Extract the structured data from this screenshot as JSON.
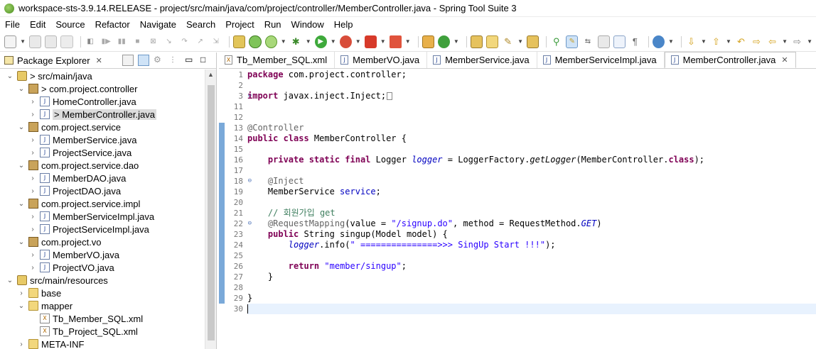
{
  "window": {
    "title": "workspace-sts-3.9.14.RELEASE - project/src/main/java/com/project/controller/MemberController.java - Spring Tool Suite 3"
  },
  "menu": [
    "File",
    "Edit",
    "Source",
    "Refactor",
    "Navigate",
    "Search",
    "Project",
    "Run",
    "Window",
    "Help"
  ],
  "explorer": {
    "title": "Package Explorer",
    "tree": [
      {
        "label": "> src/main/java",
        "icon": "source-folder-icon",
        "twisty": "expanded"
      },
      {
        "label": "> com.project.controller",
        "icon": "package-icon",
        "twisty": "expanded"
      },
      {
        "label": "HomeController.java",
        "icon": "java-file-icon",
        "twisty": "collapsed"
      },
      {
        "label": "> MemberController.java",
        "icon": "java-file-icon",
        "twisty": "collapsed"
      },
      {
        "label": "com.project.service",
        "icon": "package-icon",
        "twisty": "expanded"
      },
      {
        "label": "MemberService.java",
        "icon": "java-file-icon",
        "twisty": "collapsed"
      },
      {
        "label": "ProjectService.java",
        "icon": "java-file-icon",
        "twisty": "collapsed"
      },
      {
        "label": "com.project.service.dao",
        "icon": "package-icon",
        "twisty": "expanded"
      },
      {
        "label": "MemberDAO.java",
        "icon": "java-file-icon",
        "twisty": "collapsed"
      },
      {
        "label": "ProjectDAO.java",
        "icon": "java-file-icon",
        "twisty": "collapsed"
      },
      {
        "label": "com.project.service.impl",
        "icon": "package-icon",
        "twisty": "expanded"
      },
      {
        "label": "MemberServiceImpl.java",
        "icon": "java-file-icon",
        "twisty": "collapsed"
      },
      {
        "label": "ProjectServiceImpl.java",
        "icon": "java-file-icon",
        "twisty": "collapsed"
      },
      {
        "label": "com.project.vo",
        "icon": "package-icon",
        "twisty": "expanded"
      },
      {
        "label": "MemberVO.java",
        "icon": "java-file-icon",
        "twisty": "collapsed"
      },
      {
        "label": "ProjectVO.java",
        "icon": "java-file-icon",
        "twisty": "collapsed"
      },
      {
        "label": "src/main/resources",
        "icon": "source-folder-icon",
        "twisty": "expanded"
      },
      {
        "label": "base",
        "icon": "folder-icon",
        "twisty": "collapsed"
      },
      {
        "label": "mapper",
        "icon": "folder-icon",
        "twisty": "expanded"
      },
      {
        "label": "Tb_Member_SQL.xml",
        "icon": "xml-file-icon",
        "twisty": ""
      },
      {
        "label": "Tb_Project_SQL.xml",
        "icon": "xml-file-icon",
        "twisty": ""
      },
      {
        "label": "META-INF",
        "icon": "folder-icon",
        "twisty": "collapsed"
      }
    ]
  },
  "editor": {
    "tabs": [
      {
        "label": "Tb_Member_SQL.xml",
        "active": false
      },
      {
        "label": "MemberVO.java",
        "active": false
      },
      {
        "label": "MemberService.java",
        "active": false
      },
      {
        "label": "MemberServiceImpl.java",
        "active": false
      },
      {
        "label": "MemberController.java",
        "active": true
      }
    ],
    "line_numbers": [
      "1",
      "2",
      "3",
      "11",
      "12",
      "13",
      "14",
      "15",
      "16",
      "17",
      "18",
      "19",
      "20",
      "21",
      "22",
      "23",
      "24",
      "25",
      "26",
      "27",
      "28",
      "29",
      "30"
    ],
    "lines": {
      "l1_kw": "package",
      "l1_rest": " com.project.controller;",
      "l3_kw": "import",
      "l3_rest": " javax.inject.Inject;",
      "l13": "@Controller",
      "l14_kw": "public class",
      "l14_rest": " MemberController {",
      "l16_kw": "    private static final",
      "l16_a": " Logger ",
      "l16_b": "logger",
      "l16_c": " = LoggerFactory.",
      "l16_d": "getLogger",
      "l16_e": "(MemberController.",
      "l16_f": "class",
      "l16_g": ");",
      "l18": "    @Inject",
      "l19_a": "    MemberService ",
      "l19_b": "service",
      "l19_c": ";",
      "l21": "    // 회원가입 get",
      "l22_a": "    @RequestMapping",
      "l22_b": "(value = ",
      "l22_c": "\"/signup.do\"",
      "l22_d": ", method = RequestMethod.",
      "l22_e": "GET",
      "l22_f": ")",
      "l23_kw": "    public",
      "l23_rest": " String singup(Model model) {",
      "l24_a": "        ",
      "l24_b": "logger",
      "l24_c": ".info(",
      "l24_d": "\" ===============>>> SingUp Start !!!\"",
      "l24_e": ");",
      "l26_kw": "        return",
      "l26_b": " ",
      "l26_c": "\"member/singup\"",
      "l26_d": ";",
      "l27": "    }",
      "l29": "}"
    }
  }
}
